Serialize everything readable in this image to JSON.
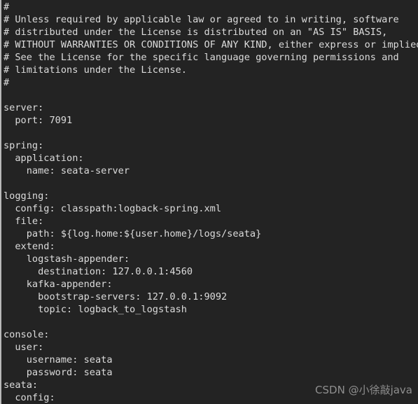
{
  "editor": {
    "language": "yaml",
    "background_color": "#232323",
    "text_color": "#dcdcdc",
    "gutter_border_color": "#b9b9b9",
    "lines": [
      "#",
      "# Unless required by applicable law or agreed to in writing, software",
      "# distributed under the License is distributed on an \"AS IS\" BASIS,",
      "# WITHOUT WARRANTIES OR CONDITIONS OF ANY KIND, either express or implied.",
      "# See the License for the specific language governing permissions and",
      "# limitations under the License.",
      "#",
      "",
      "server:",
      "  port: 7091",
      "",
      "spring:",
      "  application:",
      "    name: seata-server",
      "",
      "logging:",
      "  config: classpath:logback-spring.xml",
      "  file:",
      "    path: ${log.home:${user.home}/logs/seata}",
      "  extend:",
      "    logstash-appender:",
      "      destination: 127.0.0.1:4560",
      "    kafka-appender:",
      "      bootstrap-servers: 127.0.0.1:9092",
      "      topic: logback_to_logstash",
      "",
      "console:",
      "  user:",
      "    username: seata",
      "    password: seata",
      "seata:",
      "  config:"
    ]
  },
  "watermark": {
    "text": "CSDN @小徐敲java",
    "color": "#8f8f8f"
  }
}
